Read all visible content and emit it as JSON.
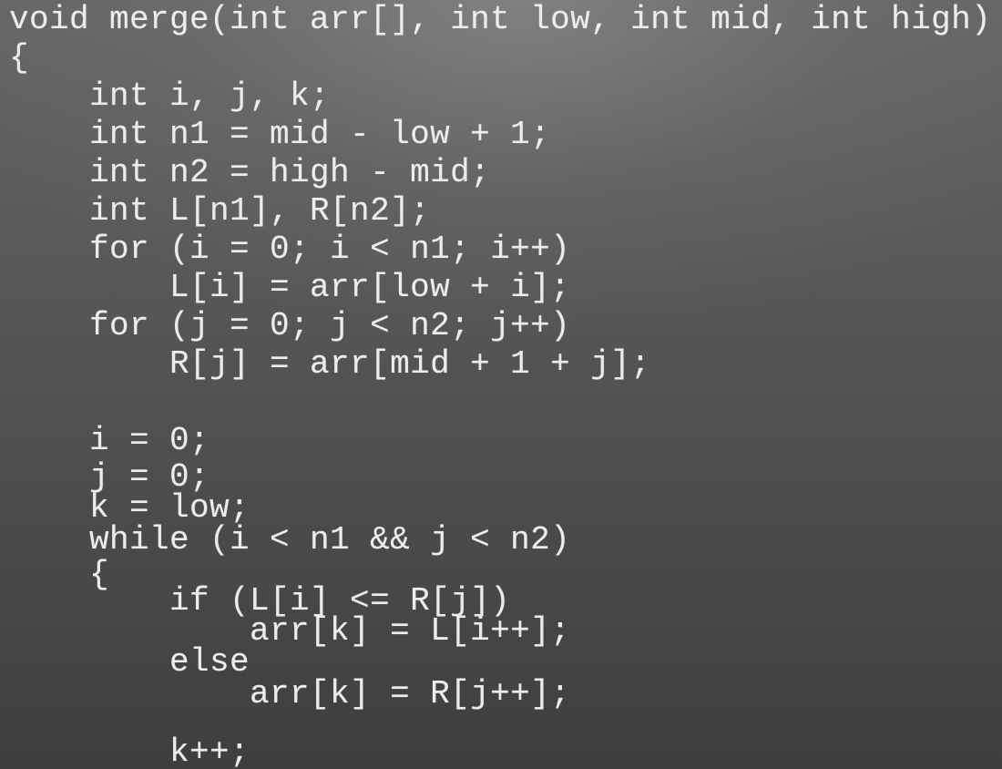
{
  "code": {
    "lines": [
      "void merge(int arr[], int low, int mid, int high)",
      "{",
      "    int i, j, k;",
      "    int n1 = mid - low + 1;",
      "    int n2 = high - mid;",
      "    int L[n1], R[n2];",
      "    for (i = 0; i < n1; i++)",
      "        L[i] = arr[low + i];",
      "    for (j = 0; j < n2; j++)",
      "        R[j] = arr[mid + 1 + j];",
      "",
      "    i = 0;",
      "    j = 0;",
      "    k = low;",
      "    while (i < n1 && j < n2)",
      "    {",
      "        if (L[i] <= R[j])",
      "            arr[k] = L[i++];",
      "        else",
      "            arr[k] = R[j++];",
      "",
      "        k++;"
    ]
  }
}
